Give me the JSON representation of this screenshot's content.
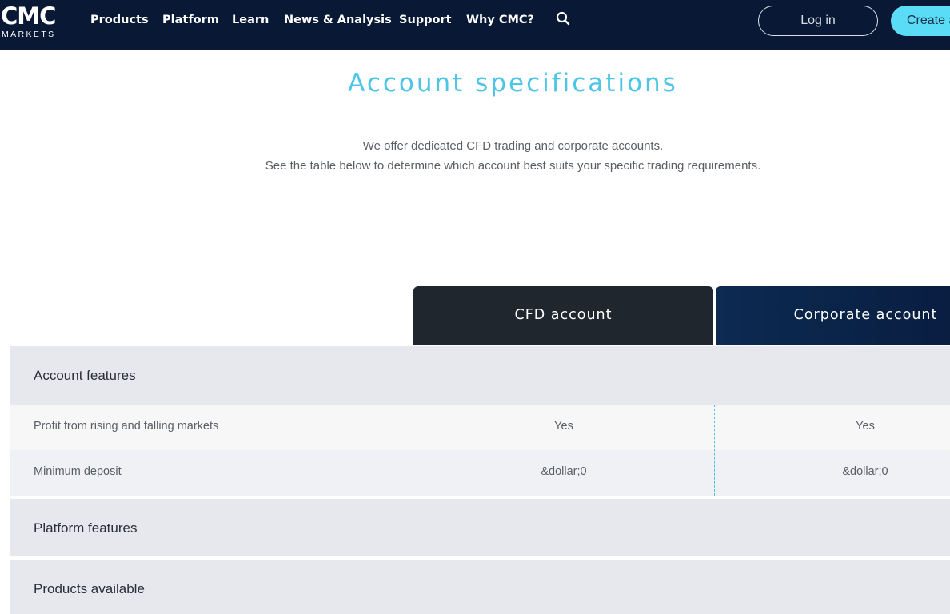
{
  "nav": {
    "logo_mark": "CMC",
    "logo_sub": "MARKETS",
    "items": [
      {
        "label": "Products"
      },
      {
        "label": "Platform"
      },
      {
        "label": "Learn"
      },
      {
        "label": "News & Analysis"
      },
      {
        "label": "Support"
      },
      {
        "label": "Why CMC?"
      }
    ],
    "search_icon": "search-icon",
    "login_label": "Log in",
    "create_label": "Create account"
  },
  "page": {
    "title": "Account specifications",
    "intro_line1": "We offer dedicated CFD trading and corporate accounts.",
    "intro_line2": "See the table below to determine which account best suits your specific trading requirements."
  },
  "table": {
    "columns": [
      "CFD account",
      "Corporate account"
    ],
    "sections": [
      {
        "title": "Account features",
        "rows": [
          {
            "label": "Profit from rising and falling markets",
            "values": [
              "Yes",
              "Yes"
            ]
          },
          {
            "label": "Minimum deposit",
            "values": [
              "&dollar;0",
              "&dollar;0"
            ]
          }
        ]
      },
      {
        "title": "Platform features"
      },
      {
        "title": "Products available"
      }
    ]
  },
  "colors": {
    "nav_bg": "#091834",
    "accent": "#4cc5e6",
    "create_btn": "#5adcf6",
    "cfd_header": "#1f262d",
    "corp_header": "#0c2a52"
  }
}
